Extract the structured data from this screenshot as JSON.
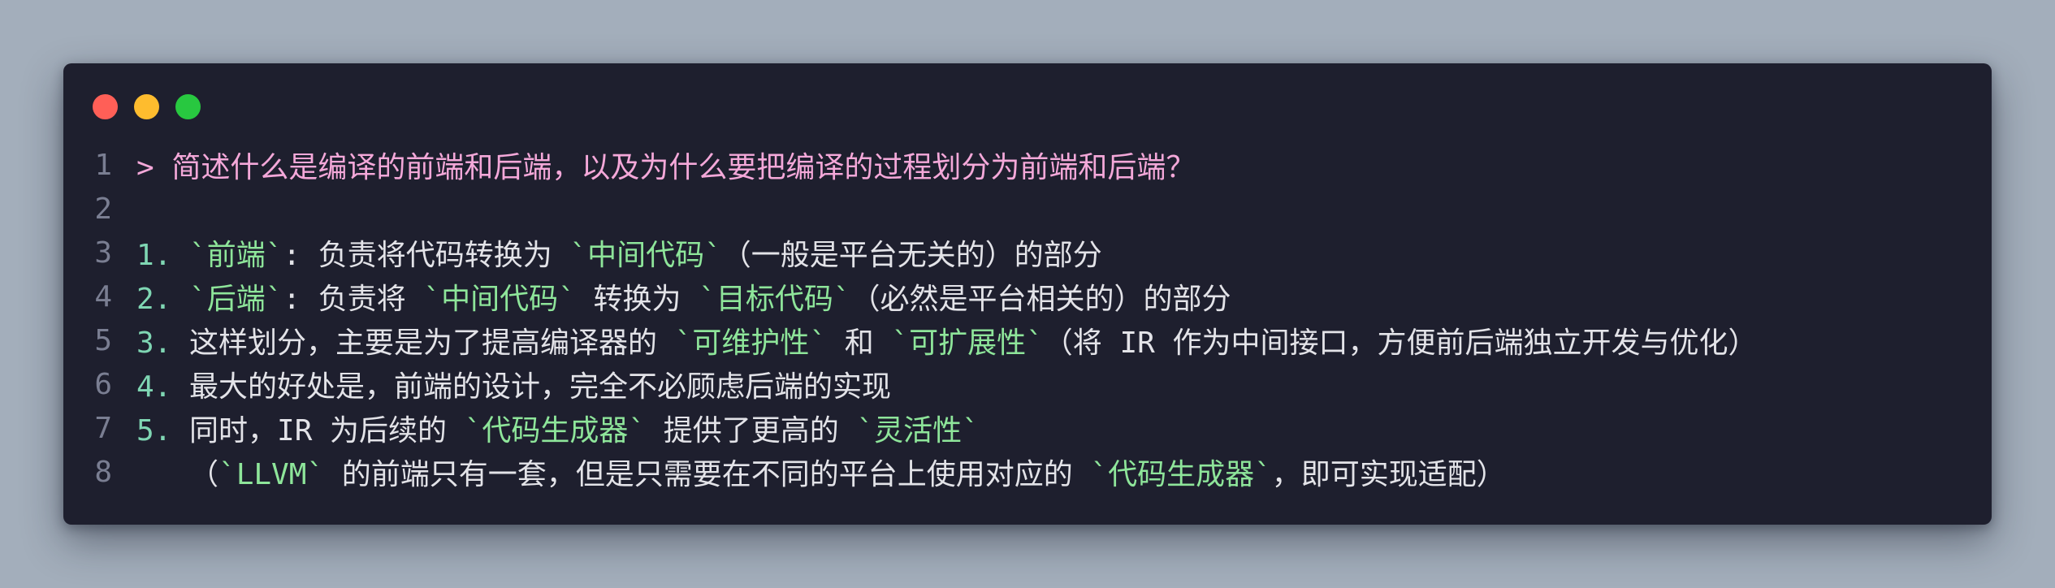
{
  "colors": {
    "background": "#a3aebb",
    "window": "#1e1f2e",
    "close": "#ff5f57",
    "minimize": "#febc2e",
    "zoom": "#28c840",
    "quote": "#f4a8d9",
    "list_number": "#7fd6b3",
    "highlight": "#8ee59a",
    "text": "#e3e3e8",
    "line_number": "#7a7e92"
  },
  "lines": [
    {
      "n": "1",
      "segments": [
        {
          "t": "> 简述什么是编译的前端和后端，以及为什么要把编译的过程划分为前端和后端？",
          "c": "quote"
        }
      ]
    },
    {
      "n": "2",
      "segments": []
    },
    {
      "n": "3",
      "segments": [
        {
          "t": "1. ",
          "c": "num"
        },
        {
          "t": "`前端`",
          "c": "hl"
        },
        {
          "t": ": 负责将代码转换为 ",
          "c": "plain"
        },
        {
          "t": "`中间代码`",
          "c": "hl"
        },
        {
          "t": "（一般是平台无关的）的部分",
          "c": "plain"
        }
      ]
    },
    {
      "n": "4",
      "segments": [
        {
          "t": "2. ",
          "c": "num"
        },
        {
          "t": "`后端`",
          "c": "hl"
        },
        {
          "t": ": 负责将 ",
          "c": "plain"
        },
        {
          "t": "`中间代码`",
          "c": "hl"
        },
        {
          "t": " 转换为 ",
          "c": "plain"
        },
        {
          "t": "`目标代码`",
          "c": "hl"
        },
        {
          "t": "（必然是平台相关的）的部分",
          "c": "plain"
        }
      ]
    },
    {
      "n": "5",
      "segments": [
        {
          "t": "3. ",
          "c": "num"
        },
        {
          "t": "这样划分，主要是为了提高编译器的 ",
          "c": "plain"
        },
        {
          "t": "`可维护性`",
          "c": "hl"
        },
        {
          "t": " 和 ",
          "c": "plain"
        },
        {
          "t": "`可扩展性`",
          "c": "hl"
        },
        {
          "t": "（将 IR 作为中间接口，方便前后端独立开发与优化）",
          "c": "plain"
        }
      ]
    },
    {
      "n": "6",
      "segments": [
        {
          "t": "4. ",
          "c": "num"
        },
        {
          "t": "最大的好处是，前端的设计，完全不必顾虑后端的实现",
          "c": "plain"
        }
      ]
    },
    {
      "n": "7",
      "segments": [
        {
          "t": "5. ",
          "c": "num"
        },
        {
          "t": "同时，IR 为后续的 ",
          "c": "plain"
        },
        {
          "t": "`代码生成器`",
          "c": "hl"
        },
        {
          "t": " 提供了更高的 ",
          "c": "plain"
        },
        {
          "t": "`灵活性`",
          "c": "hl"
        }
      ]
    },
    {
      "n": "8",
      "segments": [
        {
          "t": "   （",
          "c": "plain"
        },
        {
          "t": "`LLVM`",
          "c": "hl"
        },
        {
          "t": " 的前端只有一套，但是只需要在不同的平台上使用对应的 ",
          "c": "plain"
        },
        {
          "t": "`代码生成器`",
          "c": "hl"
        },
        {
          "t": "，即可实现适配）",
          "c": "plain"
        }
      ]
    }
  ]
}
